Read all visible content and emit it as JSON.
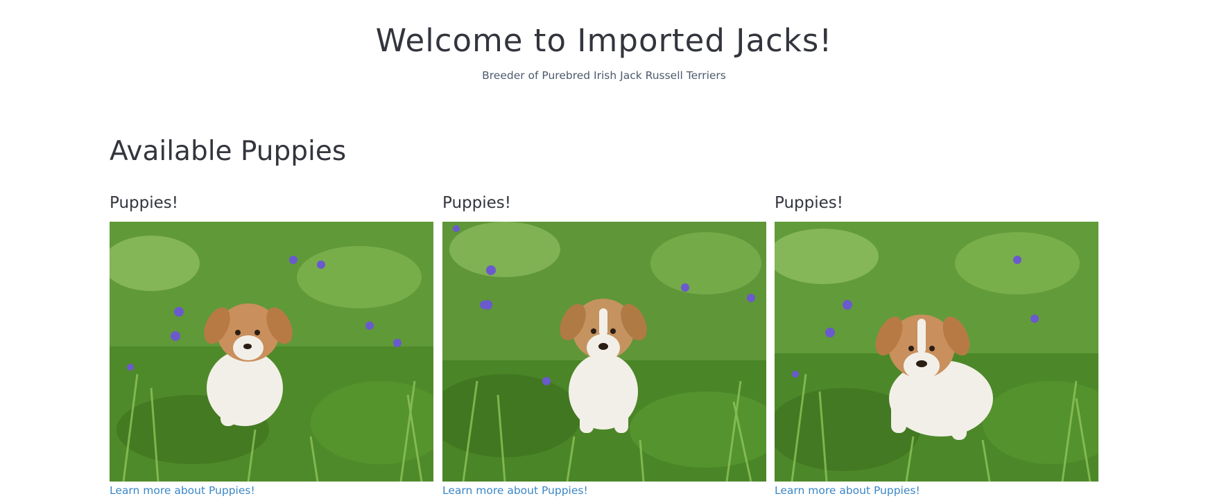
{
  "hero": {
    "title": "Welcome to Imported Jacks!",
    "subtitle": "Breeder of Purebred Irish Jack Russell Terriers"
  },
  "section": {
    "title": "Available Puppies"
  },
  "cards": [
    {
      "heading": "Puppies!",
      "image_alt": "Jack Russell puppy sitting in grass and violets",
      "link_label": "Learn more about Puppies!"
    },
    {
      "heading": "Puppies!",
      "image_alt": "Jack Russell puppy sitting in grass and violets",
      "link_label": "Learn more about Puppies!"
    },
    {
      "heading": "Puppies!",
      "image_alt": "Jack Russell puppy sitting in grass and violets",
      "link_label": "Learn more about Puppies!"
    }
  ],
  "colors": {
    "text": "#33353d",
    "subtitle": "#4b5a6b",
    "link": "#3a86c4",
    "grass": "#4f8a2a",
    "violet": "#6a5acd",
    "puppy_tan": "#c98f5c",
    "puppy_white": "#f2efe8"
  }
}
